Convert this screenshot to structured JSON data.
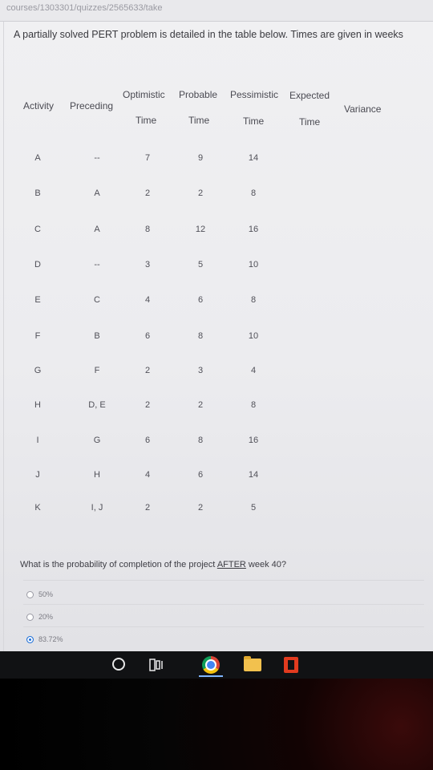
{
  "breadcrumb": "courses/1303301/quizzes/2565633/take",
  "question": "A partially solved PERT problem is detailed in the table below. Times are given in weeks",
  "table": {
    "headers": {
      "activity": "Activity",
      "preceding": "Preceding",
      "optimistic_1": "Optimistic",
      "optimistic_2": "Time",
      "probable_1": "Probable",
      "probable_2": "Time",
      "pessimistic_1": "Pessimistic",
      "pessimistic_2": "Time",
      "expected_1": "Expected",
      "expected_2": "Time",
      "variance": "Variance"
    },
    "rows": [
      {
        "activity": "A",
        "preceding": "--",
        "optimistic": "7",
        "probable": "9",
        "pessimistic": "14"
      },
      {
        "activity": "B",
        "preceding": "A",
        "optimistic": "2",
        "probable": "2",
        "pessimistic": "8"
      },
      {
        "activity": "C",
        "preceding": "A",
        "optimistic": "8",
        "probable": "12",
        "pessimistic": "16"
      },
      {
        "activity": "D",
        "preceding": "--",
        "optimistic": "3",
        "probable": "5",
        "pessimistic": "10"
      },
      {
        "activity": "E",
        "preceding": "C",
        "optimistic": "4",
        "probable": "6",
        "pessimistic": "8"
      },
      {
        "activity": "F",
        "preceding": "B",
        "optimistic": "6",
        "probable": "8",
        "pessimistic": "10"
      },
      {
        "activity": "G",
        "preceding": "F",
        "optimistic": "2",
        "probable": "3",
        "pessimistic": "4"
      },
      {
        "activity": "H",
        "preceding": "D, E",
        "optimistic": "2",
        "probable": "2",
        "pessimistic": "8"
      },
      {
        "activity": "I",
        "preceding": "G",
        "optimistic": "6",
        "probable": "8",
        "pessimistic": "16"
      },
      {
        "activity": "J",
        "preceding": "H",
        "optimistic": "4",
        "probable": "6",
        "pessimistic": "14"
      },
      {
        "activity": "K",
        "preceding": "I, J",
        "optimistic": "2",
        "probable": "2",
        "pessimistic": "5"
      }
    ]
  },
  "probability_question": {
    "before": "What is the probability of completion of the project ",
    "emphasis": "AFTER",
    "after": " week 40?"
  },
  "options": [
    {
      "label": "50%",
      "selected": false
    },
    {
      "label": "20%",
      "selected": false
    },
    {
      "label": "83.72%",
      "selected": true
    }
  ],
  "taskbar_icons": [
    "cortana-icon",
    "task-view-icon",
    "chrome-icon",
    "file-explorer-icon",
    "office-icon"
  ],
  "colors": {
    "selected_radio": "#1e6fd8",
    "taskbar": "#111214"
  }
}
